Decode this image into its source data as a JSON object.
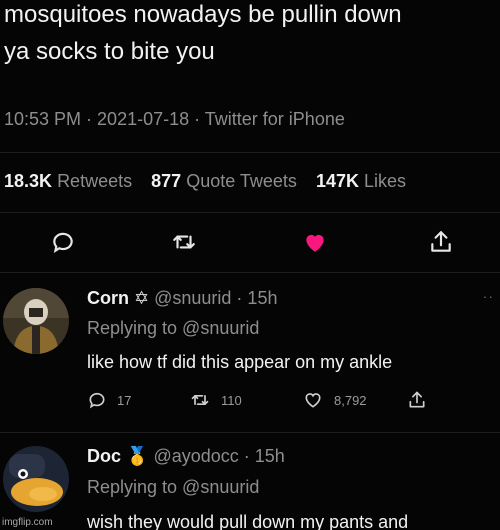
{
  "tweet": {
    "line1": "mosquitoes nowadays be pullin down",
    "line2": "ya socks to bite you",
    "meta": "10:53 PM · 2021-07-18 · Twitter for iPhone",
    "retweets_count": "18.3K",
    "retweets_label": "Retweets",
    "quotes_count": "877",
    "quotes_label": "Quote Tweets",
    "likes_count": "147K",
    "likes_label": "Likes"
  },
  "actions": {
    "icons": [
      "comment-icon",
      "retweet-icon",
      "heart-filled-icon",
      "share-icon"
    ],
    "heart_color": "#f91880"
  },
  "replies": [
    {
      "name": "Corn",
      "badge": "✡",
      "handle_time": "@snuurid · 15h",
      "replying": "Replying to @snuurid",
      "text": "like how tf did this appear on my ankle",
      "reply_count": "17",
      "retweet_count": "110",
      "like_count": "8,792"
    },
    {
      "name": "Doc",
      "badge": "🥇",
      "handle_time": "@ayodocc · 15h",
      "replying": "Replying to @snuurid",
      "text": "wish they would pull down my pants and"
    }
  ],
  "more_label": "··",
  "watermark": "imgflip.com"
}
